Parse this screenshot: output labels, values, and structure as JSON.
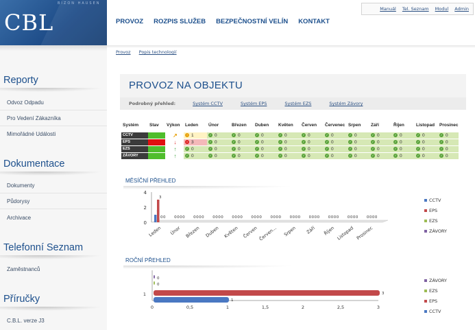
{
  "logo": {
    "text": "CBL",
    "tagline": "BIZON HAUSEN"
  },
  "topnav": [
    "PROVOZ",
    "ROZPIS SLUŽEB",
    "BEZPEČNOSTNÍ VELÍN",
    "KONTAKT"
  ],
  "utility_links": [
    "Manuál",
    "Tel. Seznam",
    "Modul",
    "Admin"
  ],
  "breadcrumbs": [
    "Provoz",
    "Popis technologií"
  ],
  "sidebar": {
    "sections": [
      {
        "title": "Reporty",
        "items": [
          "Odvoz Odpadu",
          "Pro Vedení Zákazníka",
          "Mimořádné Události"
        ]
      },
      {
        "title": "Dokumentace",
        "items": [
          "Dokumenty",
          "Půdorysy",
          "Archivace"
        ]
      },
      {
        "title": "Telefonní Seznam",
        "items": [
          "Zaměstnanců"
        ]
      },
      {
        "title": "Příručky",
        "items": [
          "C.B.L. verze J3"
        ]
      }
    ]
  },
  "page": {
    "title": "PROVOZ NA OBJEKTU",
    "detail_label": "Podrobný přehled:",
    "detail_links": [
      "Systém CCTV",
      "Systém EPS",
      "Systém EZS",
      "Systém Závory"
    ]
  },
  "table": {
    "headers": [
      "Systém",
      "Stav",
      "Výkon",
      "Leden",
      "Únor",
      "Březen",
      "Duben",
      "Květen",
      "Červen",
      "Červenec",
      "Srpen",
      "Září",
      "Říjen",
      "Listopad",
      "Prosinec"
    ],
    "rows": [
      {
        "system": "CCTV",
        "status": "green",
        "trend": "↗",
        "trend_color": "#e7a10a",
        "values": [
          "1",
          "0",
          "0",
          "0",
          "0",
          "0",
          "0",
          "0",
          "0",
          "0",
          "0",
          "0"
        ],
        "first_state": "warn"
      },
      {
        "system": "EPS",
        "status": "red",
        "trend": "↓",
        "trend_color": "#d22",
        "values": [
          "3",
          "0",
          "0",
          "0",
          "0",
          "0",
          "0",
          "0",
          "0",
          "0",
          "0",
          "0"
        ],
        "first_state": "err"
      },
      {
        "system": "EZS",
        "status": "green",
        "trend": "↑",
        "trend_color": "#3aa03a",
        "values": [
          "0",
          "0",
          "0",
          "0",
          "0",
          "0",
          "0",
          "0",
          "0",
          "0",
          "0",
          "0"
        ],
        "first_state": "ok"
      },
      {
        "system": "ZÁVORY",
        "status": "green",
        "trend": "↑",
        "trend_color": "#3aa03a",
        "values": [
          "0",
          "0",
          "0",
          "0",
          "0",
          "0",
          "0",
          "0",
          "0",
          "0",
          "0",
          "0"
        ],
        "first_state": "ok"
      }
    ]
  },
  "chart_data": [
    {
      "type": "bar",
      "title": "MĚSÍČNÍ PŘEHLED",
      "categories": [
        "Leden",
        "Únor",
        "Březen",
        "Duben",
        "Květen",
        "Červen",
        "Červen...",
        "Srpen",
        "Září",
        "Říjen",
        "Listopad",
        "Prosinec"
      ],
      "series": [
        {
          "name": "CCTV",
          "color": "#4a78c2",
          "values": [
            1,
            0,
            0,
            0,
            0,
            0,
            0,
            0,
            0,
            0,
            0,
            0
          ]
        },
        {
          "name": "EPS",
          "color": "#c2494a",
          "values": [
            3,
            0,
            0,
            0,
            0,
            0,
            0,
            0,
            0,
            0,
            0,
            0
          ]
        },
        {
          "name": "EZS",
          "color": "#9bbb52",
          "values": [
            0,
            0,
            0,
            0,
            0,
            0,
            0,
            0,
            0,
            0,
            0,
            0
          ]
        },
        {
          "name": "ZÁVORY",
          "color": "#7f62a2",
          "values": [
            0,
            0,
            0,
            0,
            0,
            0,
            0,
            0,
            0,
            0,
            0,
            0
          ]
        }
      ],
      "yticks": [
        0,
        2,
        4
      ],
      "ylim": [
        0,
        4
      ],
      "legend": "right",
      "orientation": "vertical"
    },
    {
      "type": "bar",
      "title": "ROČNÍ PŘEHLED",
      "categories": [
        "1"
      ],
      "series": [
        {
          "name": "ZÁVORY",
          "color": "#7f62a2",
          "values": [
            0
          ]
        },
        {
          "name": "EZS",
          "color": "#9bbb52",
          "values": [
            0
          ]
        },
        {
          "name": "EPS",
          "color": "#c2494a",
          "values": [
            3
          ]
        },
        {
          "name": "CCTV",
          "color": "#4a78c2",
          "values": [
            1
          ]
        }
      ],
      "xticks": [
        "0",
        "0,5",
        "1",
        "1,5",
        "2",
        "2,5",
        "3"
      ],
      "xlim": [
        0,
        3
      ],
      "legend": "right",
      "orientation": "horizontal"
    }
  ]
}
